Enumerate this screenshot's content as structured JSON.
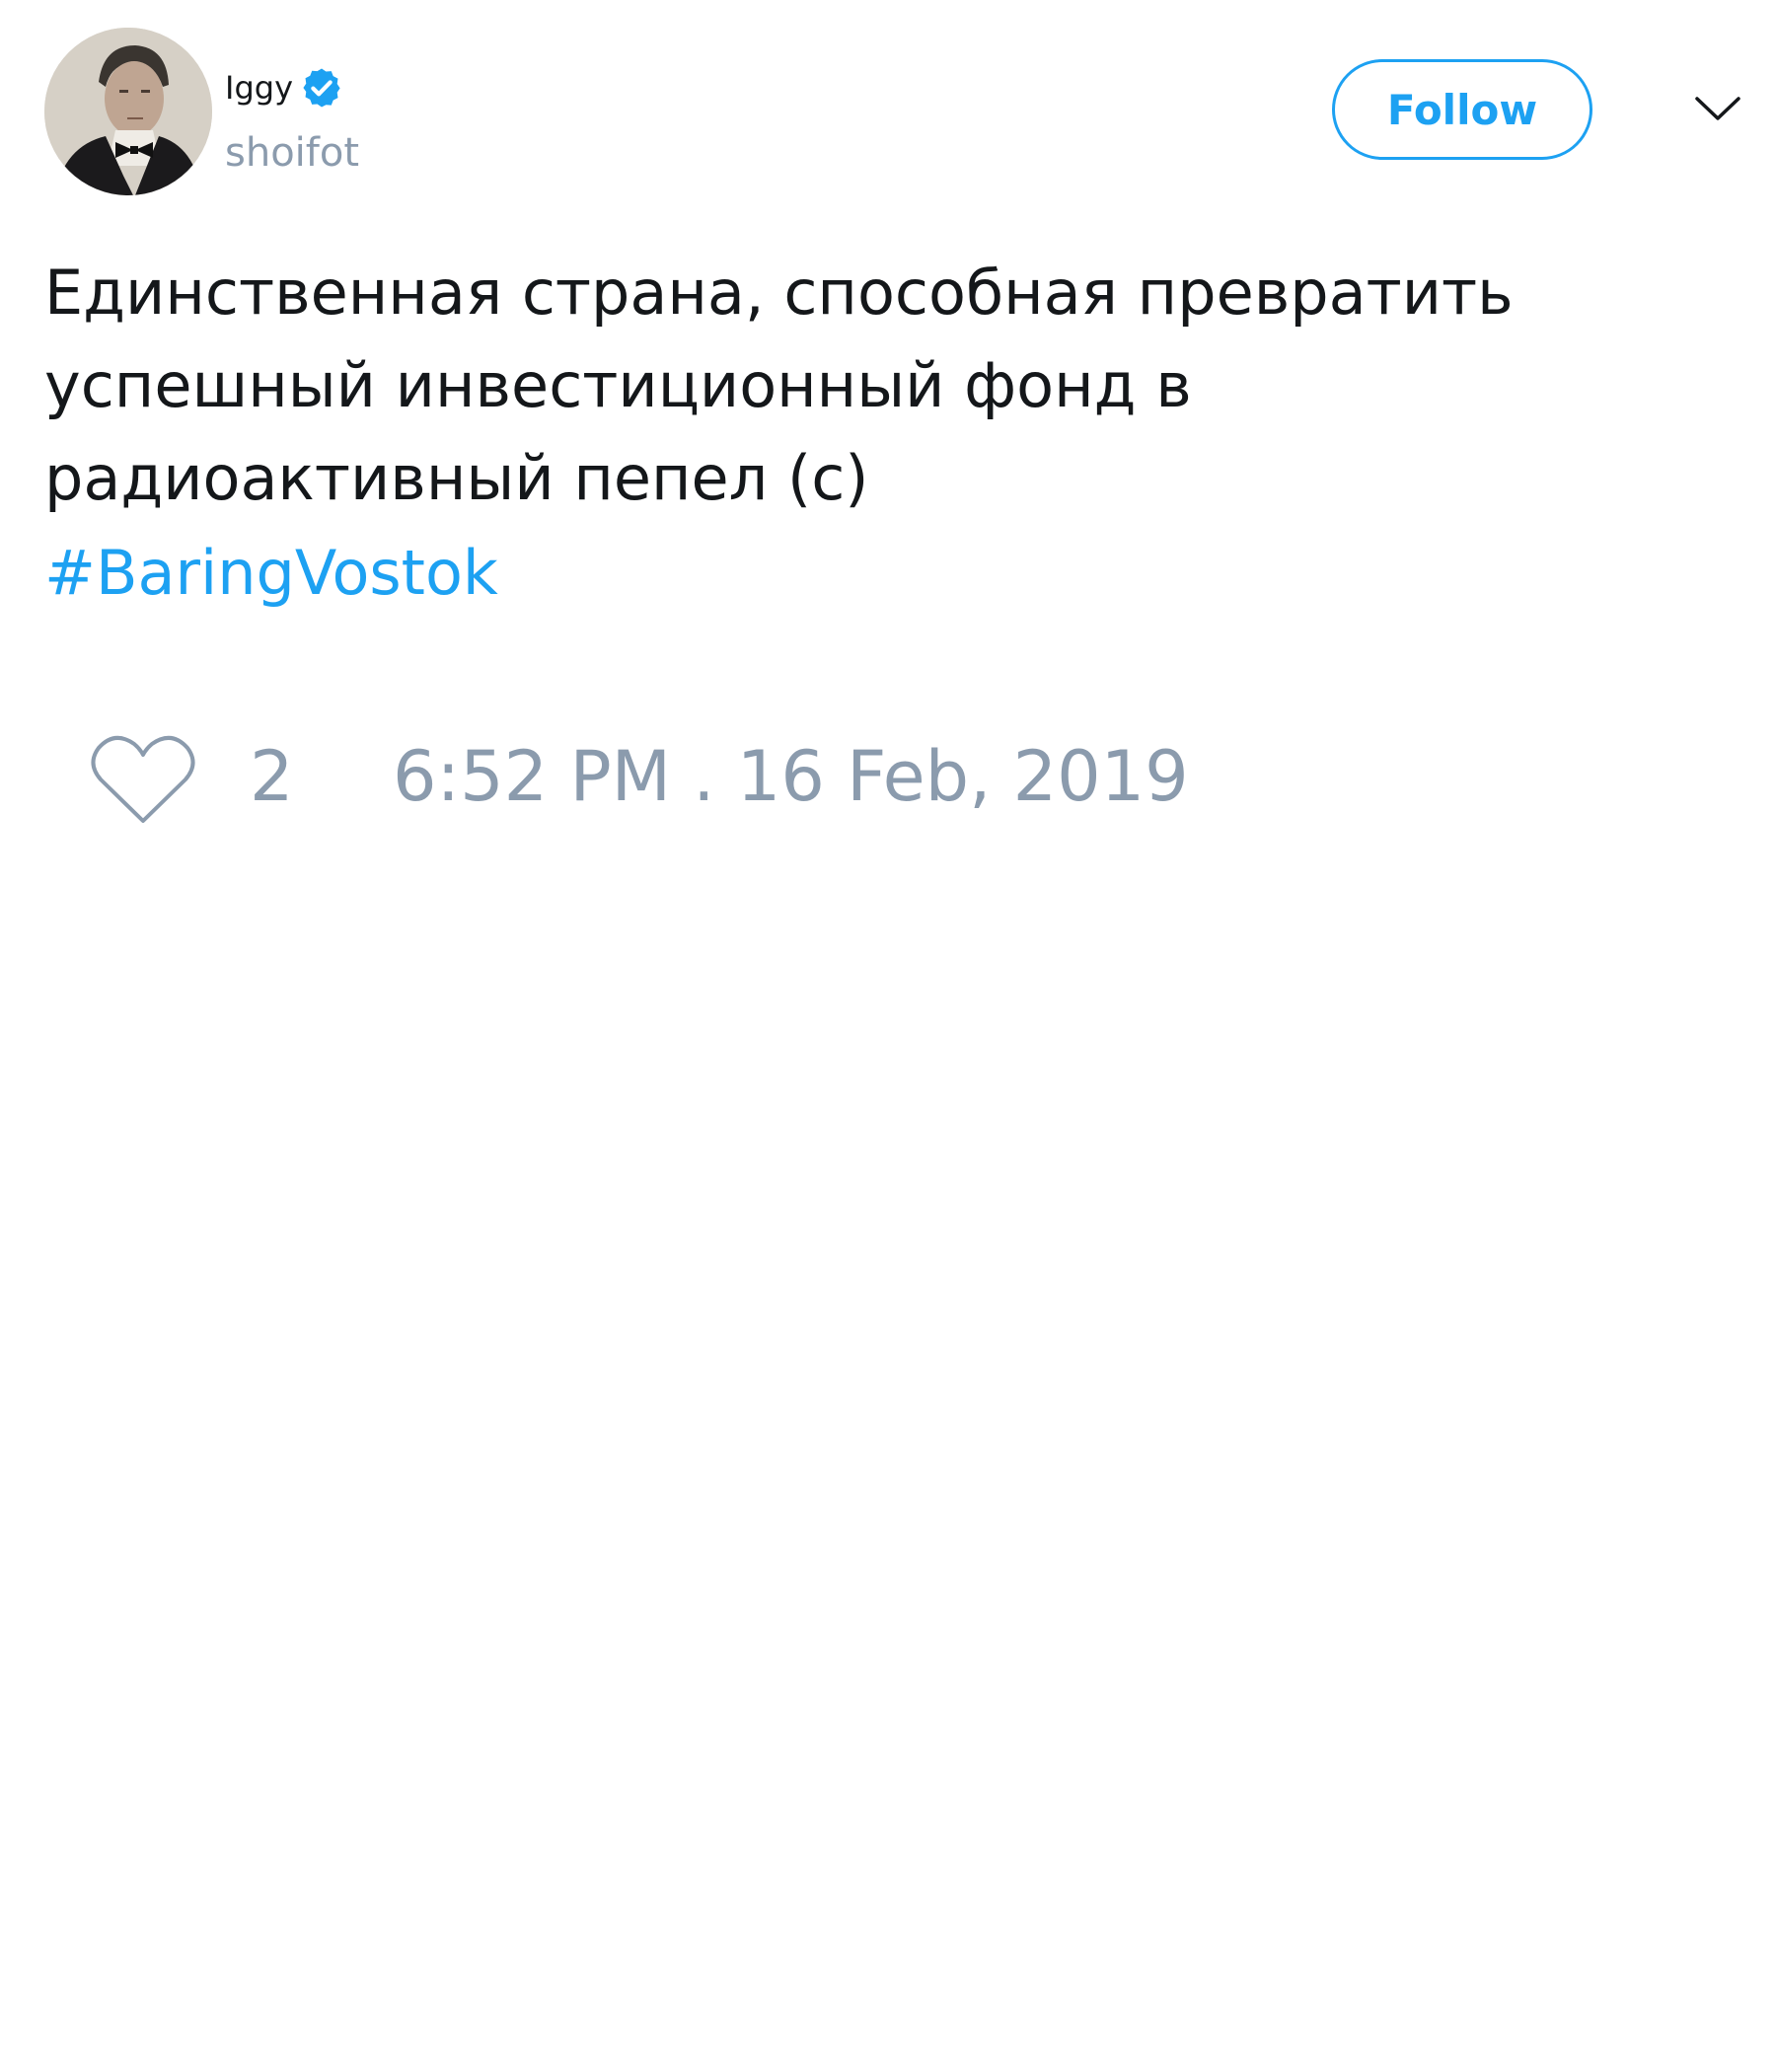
{
  "author": {
    "display_name": "Iggy",
    "handle": "shoifot",
    "verified": true,
    "avatar": "profile-photo"
  },
  "follow_button": {
    "label": "Follow"
  },
  "menu": {
    "icon": "chevron-down-icon"
  },
  "tweet": {
    "text": "Единственная страна, способная превратить\nуспешный инвестиционный фонд в\nрадиоактивный пепел (с)",
    "hashtag": "#BaringVostok"
  },
  "footer": {
    "like_icon": "heart-icon",
    "like_count": "2",
    "timestamp": "6:52 PM . 16 Feb, 2019"
  },
  "colors": {
    "accent": "#1da1f2",
    "text": "#14171a",
    "muted": "#8b9bad",
    "background": "#ffffff"
  }
}
